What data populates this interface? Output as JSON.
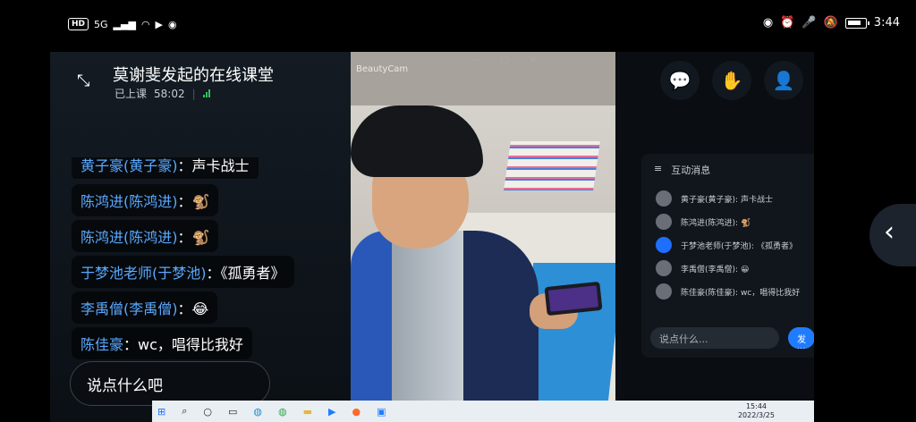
{
  "statusbar": {
    "hd": "HD",
    "network": "5G",
    "time": "3:44"
  },
  "header": {
    "title": "莫谢斐发起的在线课堂",
    "status": "已上课",
    "elapsed": "58:02"
  },
  "chat": [
    {
      "name": "黄子豪(黄子豪)",
      "text": "：声卡战士"
    },
    {
      "name": "陈鸿进(陈鸿进)",
      "text": "：🐒"
    },
    {
      "name": "陈鸿进(陈鸿进)",
      "text": "：🐒"
    },
    {
      "name": "于梦池老师(于梦池)",
      "text": "：《孤勇者》"
    },
    {
      "name": "李禹僧(李禹僧)",
      "text": "：😂"
    },
    {
      "name": "陈佳豪",
      "text": "：wc，唱得比我好"
    }
  ],
  "input": {
    "placeholder": "说点什么吧"
  },
  "video": {
    "camera_label": "BeautyCam",
    "window_controls": "— □ ✕"
  },
  "panel": {
    "title": "互动消息",
    "rows": [
      {
        "name": "黄子豪(黄子豪):",
        "text": "声卡战士"
      },
      {
        "name": "陈鸿进(陈鸿进):",
        "text": "🐒"
      },
      {
        "name": "于梦池老师(于梦池):",
        "text": "《孤勇者》"
      },
      {
        "name": "李禹僧(李禹僧):",
        "text": "😀"
      },
      {
        "name": "陈佳豪(陈佳豪):",
        "text": "wc，唱得比我好"
      }
    ],
    "input_placeholder": "说点什么...",
    "send": "发送"
  },
  "taskbar": {
    "time": "15:44",
    "date": "2022/3/25"
  },
  "icons": {
    "collapse": "collapse-icon",
    "chat": "chat-bubble-icon",
    "hand": "raise-hand-icon",
    "user": "user-icon",
    "settings": "gear-icon",
    "power": "power-icon",
    "back": "chevron-left-icon"
  },
  "colors": {
    "accent": "#1f7cff",
    "name_blue": "#5aa9ff",
    "power": "#ff6a2a",
    "signal": "#31c35a"
  }
}
